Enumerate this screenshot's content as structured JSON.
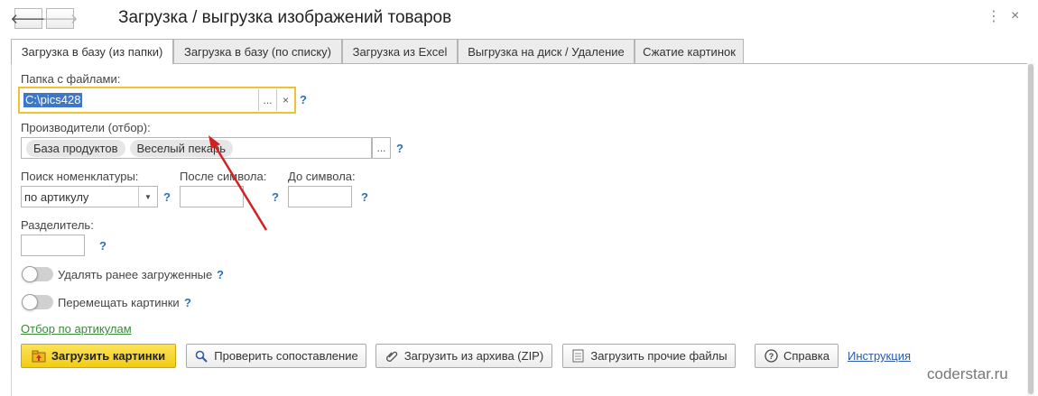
{
  "window": {
    "title": "Загрузка / выгрузка изображений товаров",
    "back_icon": "arrow-left-icon",
    "forward_icon": "arrow-right-icon",
    "more_icon": "vertical-ellipsis-icon",
    "close_icon": "close-icon",
    "close_glyph": "×"
  },
  "tabs": [
    {
      "label": "Загрузка в базу (из папки)",
      "active": true
    },
    {
      "label": "Загрузка в базу (по списку)",
      "active": false
    },
    {
      "label": "Загрузка из Excel",
      "active": false
    },
    {
      "label": "Выгрузка на диск / Удаление",
      "active": false
    },
    {
      "label": "Сжатие картинок",
      "active": false
    }
  ],
  "form": {
    "folder": {
      "label": "Папка с файлами:",
      "value": "C:\\pics428",
      "select_glyph": "...",
      "clear_glyph": "×",
      "help": "?"
    },
    "manufacturers": {
      "label": "Производители (отбор):",
      "tags": [
        "База продуктов",
        "Веселый пекарь"
      ],
      "select_glyph": "...",
      "help": "?"
    },
    "search": {
      "label": "Поиск номенклатуры:",
      "value": "по артикулу",
      "help": "?"
    },
    "after_symbol": {
      "label": "После символа:",
      "value": "",
      "help": "?"
    },
    "before_symbol": {
      "label": "До символа:",
      "value": "",
      "help": "?"
    },
    "separator": {
      "label": "Разделитель:",
      "value": "",
      "help": "?"
    },
    "delete_loaded": {
      "label": "Удалять ранее загруженные",
      "on": false,
      "help": "?"
    },
    "move_pictures": {
      "label": "Перемещать картинки",
      "on": false,
      "help": "?"
    },
    "filter_link": "Отбор по артикулам"
  },
  "buttons": {
    "upload": "Загрузить картинки",
    "check": "Проверить сопоставление",
    "zip": "Загрузить из архива (ZIP)",
    "other_files": "Загрузить прочие файлы",
    "help": "Справка",
    "instruction_link": "Инструкция"
  },
  "colors": {
    "accent_yellow": "#f2cc13",
    "focus_border": "#f0c133",
    "link_green": "#3a8a3a",
    "link_blue": "#2a5aa8",
    "help_blue": "#2c6fb5",
    "arrow_red": "#d42020"
  },
  "watermark": "coderstar.ru"
}
